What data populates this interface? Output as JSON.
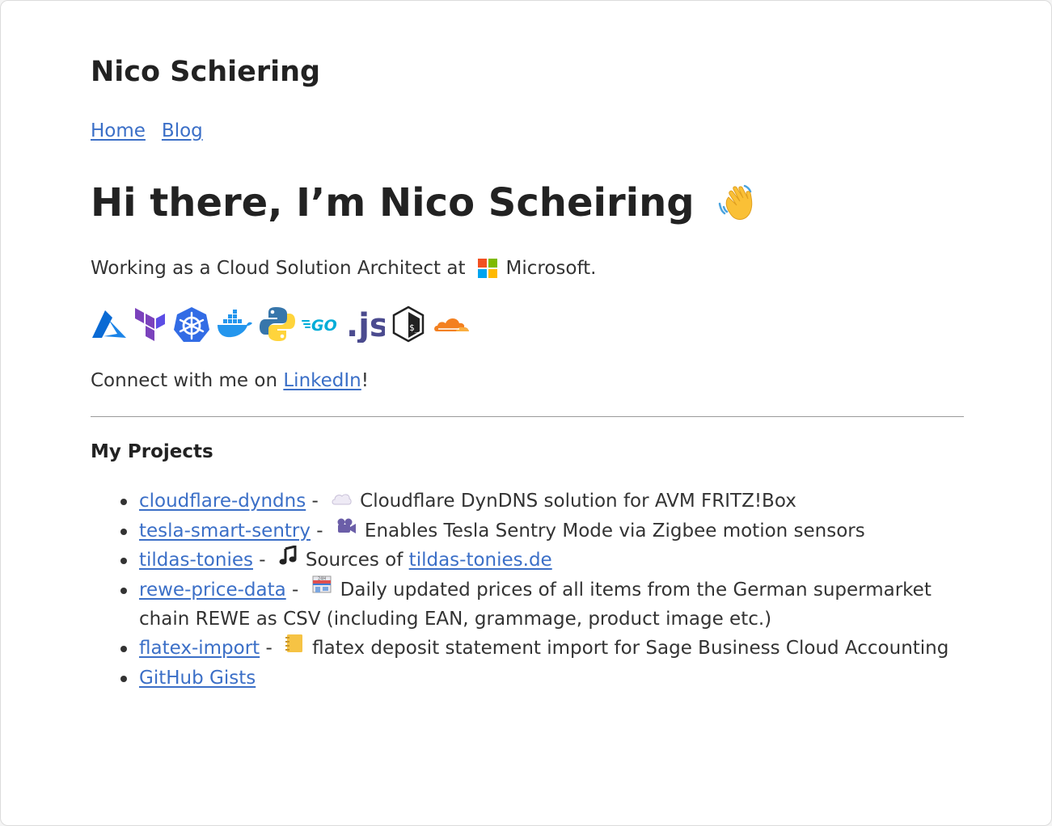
{
  "site": {
    "title": "Nico Schiering"
  },
  "nav": [
    {
      "label": "Home"
    },
    {
      "label": "Blog"
    }
  ],
  "hero": {
    "heading": "Hi there, I’m Nico Scheiring",
    "heading_icon": "waving-hand-icon"
  },
  "intro": {
    "prefix": "Working as a Cloud Solution Architect at",
    "company": "Microsoft.",
    "company_icon": "microsoft-logo-icon"
  },
  "tech_icons": [
    "azure-icon",
    "terraform-icon",
    "kubernetes-icon",
    "docker-icon",
    "python-icon",
    "go-icon",
    "javascript-icon",
    "bash-icon",
    "cloudflare-icon"
  ],
  "connect": {
    "prefix": "Connect with me on ",
    "link": "LinkedIn",
    "suffix": "!"
  },
  "projects": {
    "title": "My Projects",
    "items": [
      {
        "name": "cloudflare-dyndns",
        "sep": " - ",
        "icon": "cloud-icon",
        "description": "Cloudflare DynDNS solution for AVM FRITZ!Box"
      },
      {
        "name": "tesla-smart-sentry",
        "sep": " - ",
        "icon": "video-camera-icon",
        "description": "Enables Tesla Sentry Mode via Zigbee motion sensors"
      },
      {
        "name": "tildas-tonies",
        "sep": " - ",
        "icon": "music-note-icon",
        "description": "Sources of ",
        "link": "tildas-tonies.de"
      },
      {
        "name": "rewe-price-data",
        "sep": " - ",
        "icon": "convenience-store-icon",
        "description": "Daily updated prices of all items from the German supermarket chain REWE as CSV (including EAN, grammage, product image etc.)"
      },
      {
        "name": "flatex-import",
        "sep": " - ",
        "icon": "notebook-icon",
        "description": "flatex deposit statement import for Sage Business Cloud Accounting"
      },
      {
        "name": "GitHub Gists"
      }
    ]
  },
  "colors": {
    "link": "#3b6fc7",
    "text": "#333333",
    "heading": "#222222",
    "ms_red": "#f25022",
    "ms_green": "#7fba00",
    "ms_blue": "#00a4ef",
    "ms_yellow": "#ffb900"
  }
}
